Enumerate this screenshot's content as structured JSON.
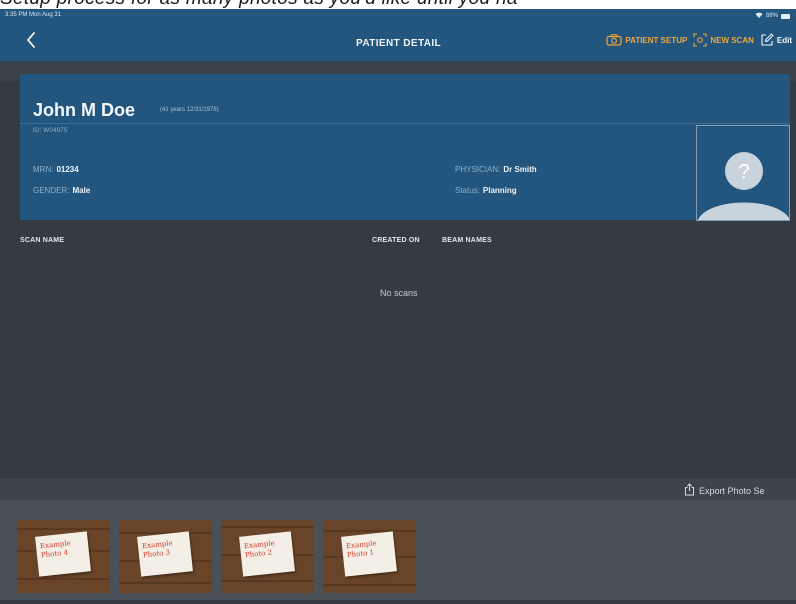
{
  "caption": {
    "text": "Setup process for as many photos as you'd like until you ha"
  },
  "status_bar": {
    "time": "3:35 PM  Mon Aug 31",
    "battery": "88%"
  },
  "nav": {
    "title": "PATIENT DETAIL",
    "patient_setup_label": "PATIENT SETUP",
    "new_scan_label": "NEW SCAN",
    "edit_label": "Edit"
  },
  "patient": {
    "name": "John M Doe",
    "age_dob": "(41 years 12/31/1978)",
    "id": "ID: W04975",
    "mrn_label": "MRN:",
    "mrn": "01234",
    "gender_label": "GENDER:",
    "gender": "Male",
    "physician_label": "PHYSICIAN:",
    "physician": "Dr Smith",
    "status_label": "Status:",
    "status": "Planning",
    "avatar_glyph": "?"
  },
  "scans_table": {
    "columns": [
      "SCAN NAME",
      "CREATED ON",
      "BEAM NAMES"
    ],
    "rows": [],
    "empty_message": "No scans"
  },
  "export": {
    "label": "Export Photo Se"
  },
  "photos": [
    {
      "note": "Example\nPhoto 4"
    },
    {
      "note": "Example\nPhoto 3"
    },
    {
      "note": "Example\nPhoto 2"
    },
    {
      "note": "Example\nPhoto 1"
    }
  ],
  "colors": {
    "nav_blue": "#22567f",
    "background": "#353b42",
    "accent_orange": "#f2a53a"
  }
}
